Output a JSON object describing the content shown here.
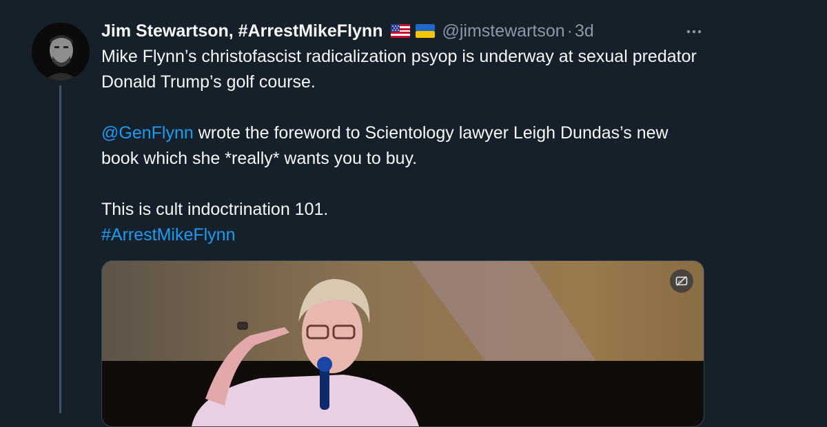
{
  "tweet": {
    "author_name": "Jim Stewartson, #ArrestMikeFlynn",
    "flags": [
      "us-flag-icon",
      "ukraine-flag-icon"
    ],
    "handle": "@jimstewartson",
    "separator": "·",
    "timestamp": "3d",
    "text": {
      "p1": "Mike Flynn’s christofascist radicalization psyop is underway at sexual predator Donald Trump’s golf course.",
      "mention": "@GenFlynn",
      "p2_rest": " wrote the foreword to Scientology lawyer Leigh Dundas’s new book which she *really* wants you to buy.",
      "p3": "This is cult indoctrination 101.",
      "hashtag": "#ArrestMikeFlynn"
    },
    "media": {
      "type": "video",
      "captions_icon": "closed-captions-off-icon"
    }
  },
  "colors": {
    "background": "#15202b",
    "text": "#f7f9f9",
    "secondary_text": "#8b98a5",
    "link": "#1d9bf0",
    "thread_line": "#425364"
  }
}
